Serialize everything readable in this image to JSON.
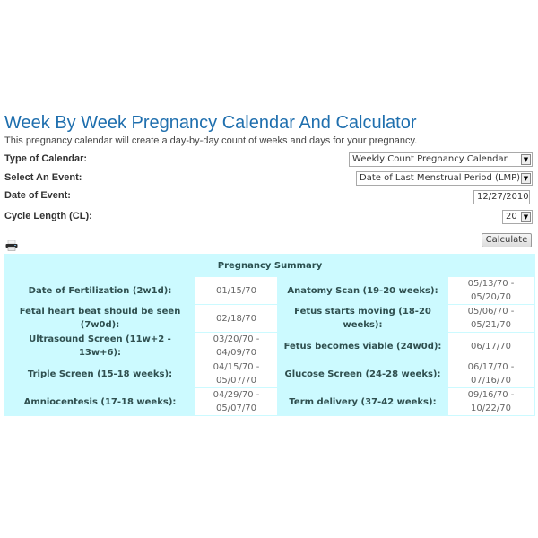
{
  "page": {
    "title": "Week By Week Pregnancy Calendar And Calculator",
    "subtitle": "This pregnancy calendar will create a day-by-day count of weeks and days for your pregnancy."
  },
  "form": {
    "calendar_type": {
      "label": "Type of Calendar:",
      "value": "Weekly Count Pregnancy Calendar"
    },
    "event": {
      "label": "Select An Event:",
      "value": "Date of Last Menstrual Period (LMP)"
    },
    "event_date": {
      "label": "Date of Event:",
      "value": "12/27/2010"
    },
    "cycle_length": {
      "label": "Cycle Length (CL):",
      "value": "20"
    },
    "calculate_label": "Calculate",
    "dropdown_arrow": "▼"
  },
  "icons": {
    "print": "printer-icon"
  },
  "summary": {
    "title": "Pregnancy Summary",
    "rows": [
      {
        "label1": "Date of Fertilization (2w1d):",
        "value1": "01/15/70",
        "label2": "Anatomy Scan (19-20 weeks):",
        "value2": "05/13/70 - 05/20/70"
      },
      {
        "label1": "Fetal heart beat should be seen (7w0d):",
        "value1": "02/18/70",
        "label2": "Fetus starts moving (18-20 weeks):",
        "value2": "05/06/70 - 05/21/70"
      },
      {
        "label1": "Ultrasound Screen (11w+2 - 13w+6):",
        "value1": "03/20/70 - 04/09/70",
        "label2": "Fetus becomes viable (24w0d):",
        "value2": "06/17/70"
      },
      {
        "label1": "Triple Screen (15-18 weeks):",
        "value1": "04/15/70 - 05/07/70",
        "label2": "Glucose Screen (24-28 weeks):",
        "value2": "06/17/70 - 07/16/70"
      },
      {
        "label1": "Amniocentesis (17-18 weeks):",
        "value1": "04/29/70 - 05/07/70",
        "label2": "Term delivery (37-42 weeks):",
        "value2": "09/16/70 - 10/22/70"
      }
    ]
  }
}
